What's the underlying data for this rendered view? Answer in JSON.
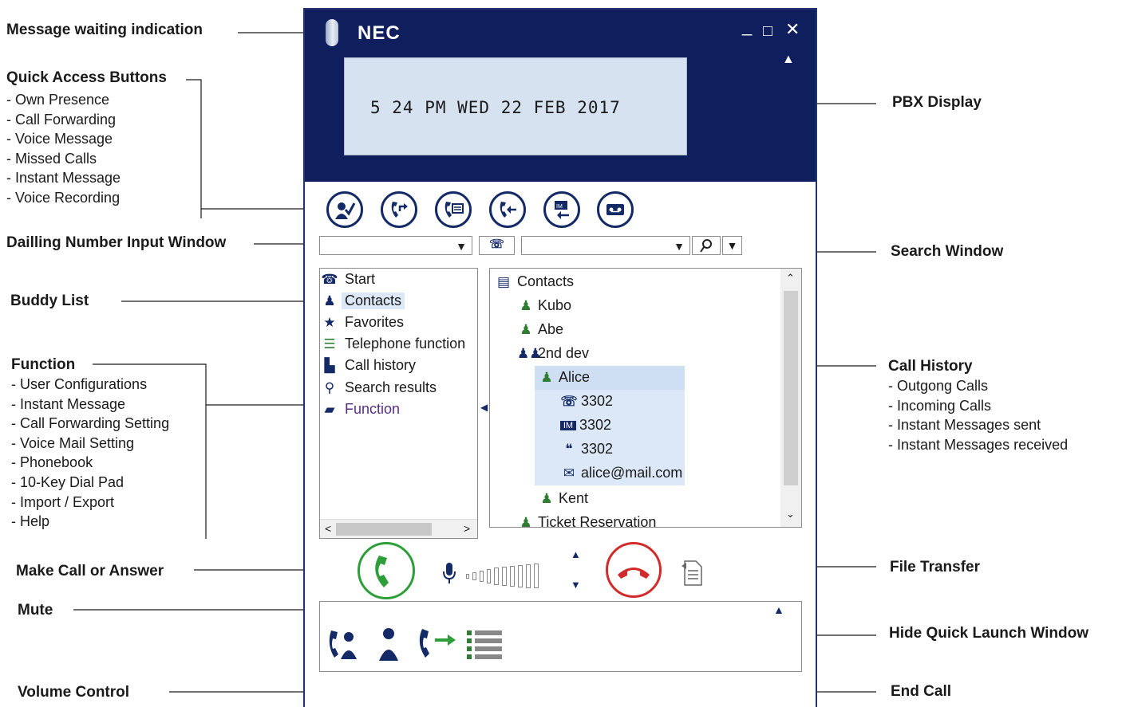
{
  "annotations": {
    "message_waiting": "Message waiting indication",
    "quick_access": {
      "title": "Quick Access Buttons",
      "items": [
        "- Own Presence",
        "- Call Forwarding",
        "- Voice Message",
        "- Missed Calls",
        "- Instant Message",
        "- Voice Recording"
      ]
    },
    "dialling_input": "Dailling Number Input Window",
    "buddy_list": "Buddy List",
    "function": {
      "title": "Function",
      "items": [
        "- User Configurations",
        "- Instant Message",
        "- Call Forwarding Setting",
        "- Voice Mail Setting",
        "- Phonebook",
        "- 10-Key Dial Pad",
        "- Import / Export",
        "- Help"
      ]
    },
    "make_call": "Make Call or Answer",
    "mute": "Mute",
    "volume": "Volume Control",
    "pbx_display": "PBX Display",
    "search_window": "Search Window",
    "call_history": {
      "title": "Call History",
      "items": [
        "- Outgong Calls",
        "- Incoming Calls",
        "- Instant Messages sent",
        "- Instant Messages received"
      ]
    },
    "file_transfer": "File Transfer",
    "hide_quick_launch": "Hide Quick Launch Window",
    "end_call": "End Call"
  },
  "window": {
    "brand": "NEC",
    "minimize": "_",
    "maximize": "□",
    "close": "✕",
    "collapse_arrow": "▲",
    "pbx_display_text": "5 24 PM WED 22 FEB 2017"
  },
  "icons": {
    "quick_buttons": [
      "own-presence-icon",
      "call-forwarding-icon",
      "voice-message-icon",
      "missed-calls-icon",
      "instant-message-icon",
      "voice-recording-icon"
    ]
  },
  "left_tree": {
    "items": [
      {
        "label": "Start",
        "icon": "start-icon"
      },
      {
        "label": "Contacts",
        "icon": "contact-icon"
      },
      {
        "label": "Favorites",
        "icon": "star-icon"
      },
      {
        "label": "Telephone function",
        "icon": "telephone-function-icon"
      },
      {
        "label": "Call history",
        "icon": "call-history-icon"
      },
      {
        "label": "Search results",
        "icon": "search-results-icon"
      },
      {
        "label": "Function",
        "icon": "folder-icon"
      }
    ]
  },
  "contacts_tree": {
    "root": "Contacts",
    "items": [
      {
        "label": "Kubo"
      },
      {
        "label": "Abe"
      },
      {
        "label": "2nd dev"
      },
      {
        "label": "Alice"
      },
      {
        "label": "3302"
      },
      {
        "label": "3302"
      },
      {
        "label": "3302"
      },
      {
        "label": "alice@mail.com"
      },
      {
        "label": "Kent"
      },
      {
        "label": "Ticket Reservation"
      }
    ]
  },
  "colors": {
    "header": "#0f1f5e",
    "display": "#d6e2f0",
    "call_green": "#2e9e3a",
    "end_red": "#d12b2b"
  }
}
